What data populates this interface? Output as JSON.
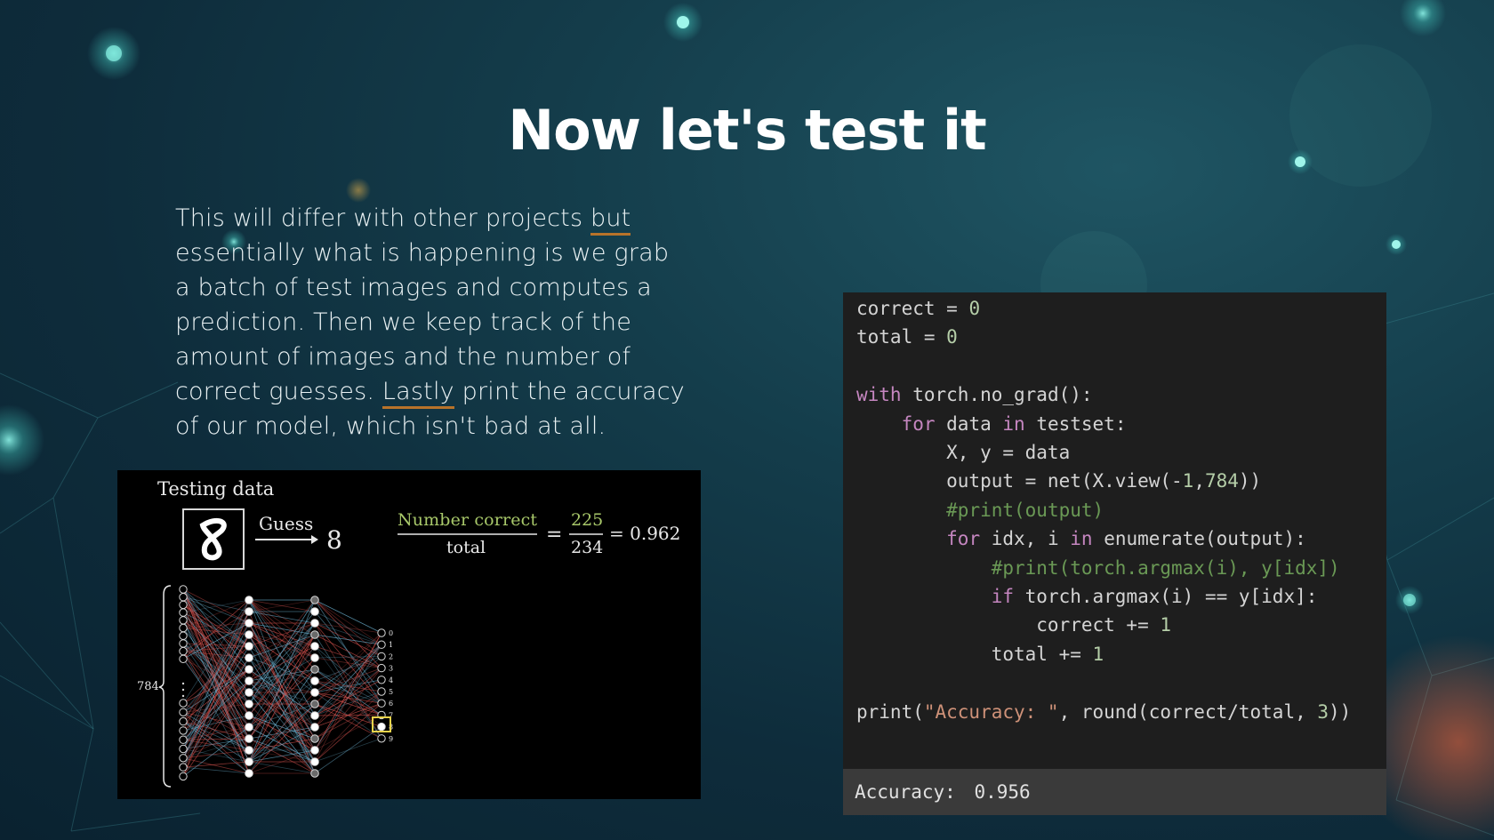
{
  "slide": {
    "title": "Now let's test it",
    "paragraph": {
      "part1": "This will differ with other projects ",
      "underline1": "but",
      "part2": " essentially what is happening is we grab a batch of test images and computes a prediction. Then we keep track of the amount of images and the number of correct guesses. ",
      "underline2": "Lastly",
      "part3": " print the accuracy of our model, which isn't bad at all."
    }
  },
  "figure": {
    "heading": "Testing data",
    "guess_label": "Guess",
    "guess_value": "8",
    "fraction_numerator_label": "Number correct",
    "fraction_denominator_label": "total",
    "equals": "=",
    "numerator": "225",
    "denominator": "234",
    "result": "= 0.962",
    "input_size_label": "784",
    "output_labels": [
      "0",
      "1",
      "2",
      "3",
      "4",
      "5",
      "6",
      "7",
      "8",
      "9"
    ]
  },
  "code_cell": {
    "lines": [
      "correct = 0",
      "total = 0",
      "",
      "with torch.no_grad():",
      "    for data in testset:",
      "        X, y = data",
      "        output = net(X.view(-1,784))",
      "        #print(output)",
      "        for idx, i in enumerate(output):",
      "            #print(torch.argmax(i), y[idx])",
      "            if torch.argmax(i) == y[idx]:",
      "                correct += 1",
      "            total += 1",
      "",
      "print(\"Accuracy: \", round(correct/total, 3))"
    ],
    "output_label": "Accuracy:",
    "output_value": "0.956"
  },
  "colors": {
    "background": "#143d4b",
    "accent_underline": "#b8732a",
    "code_bg": "#1e1e1e",
    "output_bg": "#3a3a3a"
  }
}
